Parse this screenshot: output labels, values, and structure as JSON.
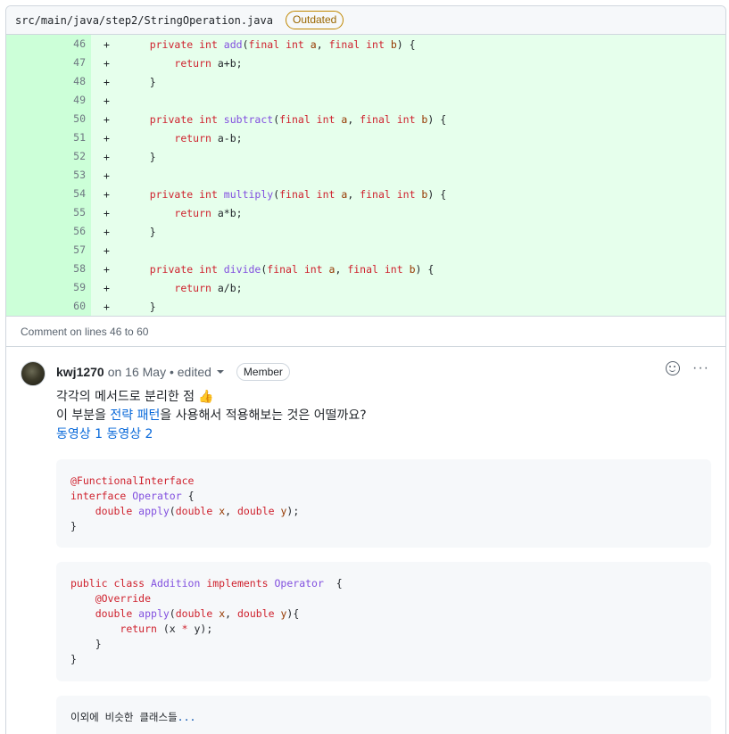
{
  "file": {
    "path": "src/main/java/step2/StringOperation.java",
    "status_badge": "Outdated"
  },
  "diff": {
    "lines": [
      {
        "num": "46",
        "marker": "+",
        "indent": "    ",
        "tokens": [
          [
            "kw",
            "private "
          ],
          [
            "kw",
            "int "
          ],
          [
            "fn",
            "add"
          ],
          [
            "plain",
            "("
          ],
          [
            "kw",
            "final "
          ],
          [
            "kw",
            "int "
          ],
          [
            "var",
            "a"
          ],
          [
            "plain",
            ", "
          ],
          [
            "kw",
            "final "
          ],
          [
            "kw",
            "int "
          ],
          [
            "var",
            "b"
          ],
          [
            "plain",
            ") {"
          ]
        ]
      },
      {
        "num": "47",
        "marker": "+",
        "indent": "        ",
        "tokens": [
          [
            "kw",
            "return "
          ],
          [
            "plain",
            "a+b;"
          ]
        ]
      },
      {
        "num": "48",
        "marker": "+",
        "indent": "    ",
        "tokens": [
          [
            "plain",
            "}"
          ]
        ]
      },
      {
        "num": "49",
        "marker": "+",
        "indent": "",
        "tokens": []
      },
      {
        "num": "50",
        "marker": "+",
        "indent": "    ",
        "tokens": [
          [
            "kw",
            "private "
          ],
          [
            "kw",
            "int "
          ],
          [
            "fn",
            "subtract"
          ],
          [
            "plain",
            "("
          ],
          [
            "kw",
            "final "
          ],
          [
            "kw",
            "int "
          ],
          [
            "var",
            "a"
          ],
          [
            "plain",
            ", "
          ],
          [
            "kw",
            "final "
          ],
          [
            "kw",
            "int "
          ],
          [
            "var",
            "b"
          ],
          [
            "plain",
            ") {"
          ]
        ]
      },
      {
        "num": "51",
        "marker": "+",
        "indent": "        ",
        "tokens": [
          [
            "kw",
            "return "
          ],
          [
            "plain",
            "a-b;"
          ]
        ]
      },
      {
        "num": "52",
        "marker": "+",
        "indent": "    ",
        "tokens": [
          [
            "plain",
            "}"
          ]
        ]
      },
      {
        "num": "53",
        "marker": "+",
        "indent": "",
        "tokens": []
      },
      {
        "num": "54",
        "marker": "+",
        "indent": "    ",
        "tokens": [
          [
            "kw",
            "private "
          ],
          [
            "kw",
            "int "
          ],
          [
            "fn",
            "multiply"
          ],
          [
            "plain",
            "("
          ],
          [
            "kw",
            "final "
          ],
          [
            "kw",
            "int "
          ],
          [
            "var",
            "a"
          ],
          [
            "plain",
            ", "
          ],
          [
            "kw",
            "final "
          ],
          [
            "kw",
            "int "
          ],
          [
            "var",
            "b"
          ],
          [
            "plain",
            ") {"
          ]
        ]
      },
      {
        "num": "55",
        "marker": "+",
        "indent": "        ",
        "tokens": [
          [
            "kw",
            "return "
          ],
          [
            "plain",
            "a*b;"
          ]
        ]
      },
      {
        "num": "56",
        "marker": "+",
        "indent": "    ",
        "tokens": [
          [
            "plain",
            "}"
          ]
        ]
      },
      {
        "num": "57",
        "marker": "+",
        "indent": "",
        "tokens": []
      },
      {
        "num": "58",
        "marker": "+",
        "indent": "    ",
        "tokens": [
          [
            "kw",
            "private "
          ],
          [
            "kw",
            "int "
          ],
          [
            "fn",
            "divide"
          ],
          [
            "plain",
            "("
          ],
          [
            "kw",
            "final "
          ],
          [
            "kw",
            "int "
          ],
          [
            "var",
            "a"
          ],
          [
            "plain",
            ", "
          ],
          [
            "kw",
            "final "
          ],
          [
            "kw",
            "int "
          ],
          [
            "var",
            "b"
          ],
          [
            "plain",
            ") {"
          ]
        ]
      },
      {
        "num": "59",
        "marker": "+",
        "indent": "        ",
        "tokens": [
          [
            "kw",
            "return "
          ],
          [
            "plain",
            "a/b;"
          ]
        ]
      },
      {
        "num": "60",
        "marker": "+",
        "indent": "    ",
        "tokens": [
          [
            "plain",
            "}"
          ]
        ]
      }
    ]
  },
  "comment_scope": "Comment on lines 46 to 60",
  "comment": {
    "author": "kwj1270",
    "meta": "on 16 May • edited",
    "badge": "Member",
    "line1": "각각의 메서드로 분리한 점",
    "line2_pre": "이 부분을 ",
    "line2_link": "전략 패턴",
    "line2_post": "을 사용해서 적용해보는 것은 어떨까요?",
    "link1": "동영상 1",
    "link2": "동영상 2"
  },
  "codeblocks": {
    "block1": [
      [
        [
          "ann",
          "@FunctionalInterface"
        ]
      ],
      [
        [
          "tp",
          "interface "
        ],
        [
          "cls",
          "Operator"
        ],
        [
          "plain",
          " {"
        ]
      ],
      [
        [
          "plain",
          "    "
        ],
        [
          "tp",
          "double "
        ],
        [
          "mth",
          "apply"
        ],
        [
          "plain",
          "("
        ],
        [
          "tp",
          "double "
        ],
        [
          "prm",
          "x"
        ],
        [
          "plain",
          ", "
        ],
        [
          "tp",
          "double "
        ],
        [
          "prm",
          "y"
        ],
        [
          "plain",
          ");"
        ]
      ],
      [
        [
          "plain",
          "}"
        ]
      ]
    ],
    "block2": [
      [
        [
          "tp",
          "public "
        ],
        [
          "tp",
          "class "
        ],
        [
          "cls",
          "Addition "
        ],
        [
          "tp",
          "implements "
        ],
        [
          "cls",
          "Operator"
        ],
        [
          "plain",
          "  {"
        ]
      ],
      [
        [
          "plain",
          "    "
        ],
        [
          "ann",
          "@Override"
        ]
      ],
      [
        [
          "plain",
          "    "
        ],
        [
          "tp",
          "double "
        ],
        [
          "mth",
          "apply"
        ],
        [
          "plain",
          "("
        ],
        [
          "tp",
          "double "
        ],
        [
          "prm",
          "x"
        ],
        [
          "plain",
          ", "
        ],
        [
          "tp",
          "double "
        ],
        [
          "prm",
          "y"
        ],
        [
          "plain",
          "){"
        ]
      ],
      [
        [
          "plain",
          "        "
        ],
        [
          "tp",
          "return "
        ],
        [
          "plain",
          "(x "
        ],
        [
          "tp",
          "* "
        ],
        [
          "plain",
          "y);"
        ]
      ],
      [
        [
          "plain",
          "    }"
        ]
      ],
      [
        [
          "plain",
          "}"
        ]
      ]
    ],
    "block3_text": "이외에 비슷한 클래스들",
    "block3_ellipsis": "..."
  },
  "colors": {
    "diff_bg": "#e6ffec",
    "diff_gutter": "#ccffd8",
    "keyword": "#cf222e",
    "function": "#8250df",
    "variable": "#953800",
    "link": "#0969da",
    "outdated": "#9a6700"
  },
  "icons": {
    "reaction": "smiley-icon",
    "more": "kebab-icon",
    "thumbs_up": "thumbs-up-icon",
    "dropdown": "chevron-down-icon"
  }
}
